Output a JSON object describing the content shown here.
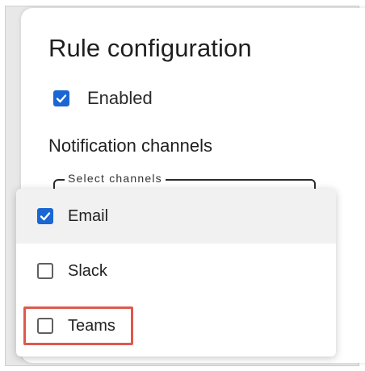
{
  "card": {
    "title": "Rule configuration",
    "enabled": {
      "label": "Enabled",
      "checked": true
    },
    "notification_section_title": "Notification channels",
    "select": {
      "legend": "Select channels"
    }
  },
  "dropdown": {
    "options": [
      {
        "label": "Email",
        "checked": true
      },
      {
        "label": "Slack",
        "checked": false
      },
      {
        "label": "Teams",
        "checked": false
      }
    ]
  },
  "colors": {
    "checkbox_checked": "#1a66d3",
    "highlight_border": "#e0584d",
    "option_hover_bg": "#f1f1f1"
  },
  "icons": {
    "check": "check-icon"
  }
}
